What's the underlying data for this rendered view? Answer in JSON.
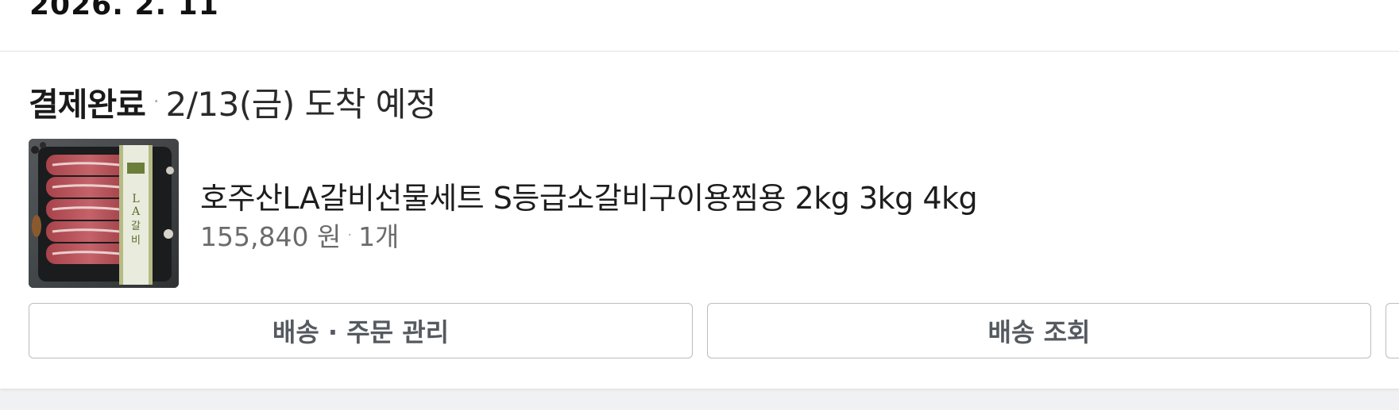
{
  "order": {
    "date": "2026. 2. 11",
    "status_title": "결제완료",
    "status_separator": "·",
    "arrival_text": "2/13(금) 도착 예정"
  },
  "product": {
    "image_alt": "LA갈비",
    "image_label": "LA갈비",
    "name": "호주산LA갈비선물세트 S등급소갈비구이용찜용 2kg 3kg 4kg",
    "price": "155,840 원",
    "separator": "·",
    "quantity": "1개"
  },
  "actions": {
    "manage_label": "배송 · 주문 관리",
    "track_label": "배송 조회"
  },
  "colors": {
    "page_background": "#f0f1f3",
    "card_background": "#ffffff",
    "button_border": "#b9bcc1",
    "button_text": "#555a60"
  }
}
